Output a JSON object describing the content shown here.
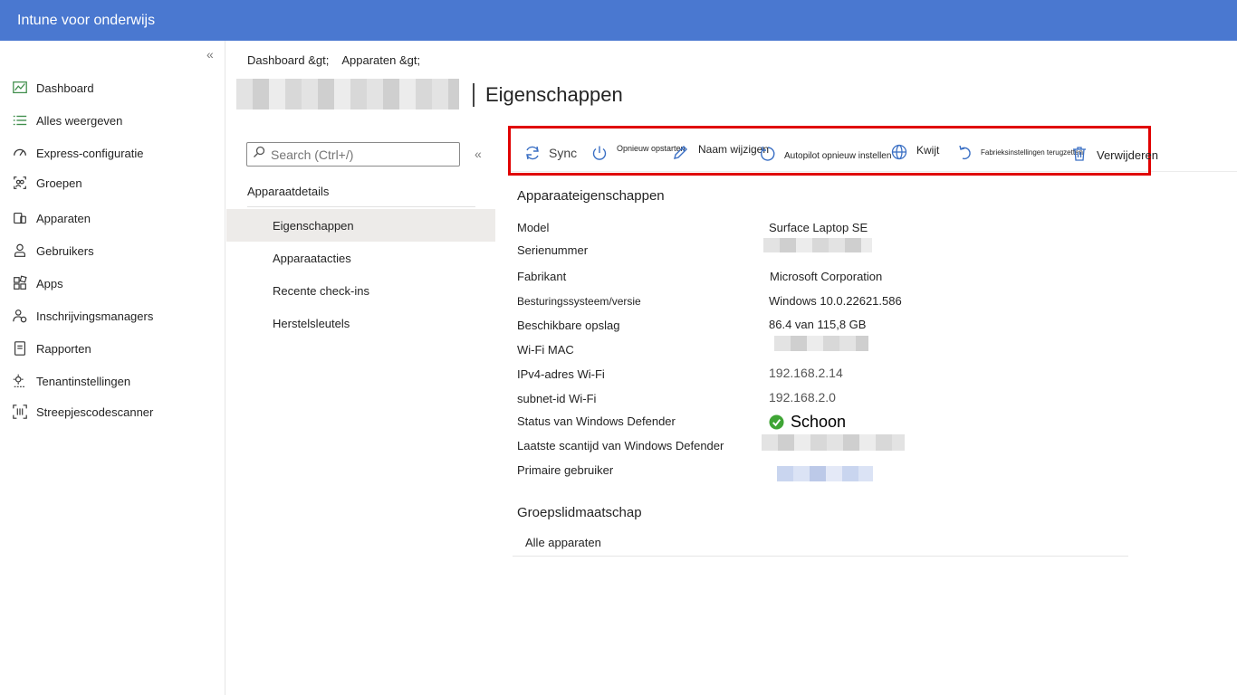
{
  "app": {
    "title": "Intune voor onderwijs"
  },
  "nav": {
    "collapse_glyph": "«",
    "items": [
      {
        "label": "Dashboard",
        "icon": "dashboard-icon"
      },
      {
        "label": "Alles weergeven",
        "icon": "list-icon"
      },
      {
        "label": "Express-configuratie",
        "icon": "gauge-icon"
      },
      {
        "label": "Groepen",
        "icon": "groups-icon"
      },
      {
        "label": "Apparaten",
        "icon": "devices-icon"
      },
      {
        "label": "Gebruikers",
        "icon": "person-icon"
      },
      {
        "label": "Apps",
        "icon": "apps-icon"
      },
      {
        "label": "Inschrijvingsmanagers",
        "icon": "enrollment-managers-icon"
      },
      {
        "label": "Rapporten",
        "icon": "reports-icon"
      },
      {
        "label": "Tenantinstellingen",
        "icon": "tenant-settings-icon"
      },
      {
        "label": "Streepjescodescanner",
        "icon": "barcode-icon"
      }
    ]
  },
  "breadcrumb": {
    "items": [
      "Dashboard &gt;",
      "Apparaten &gt;"
    ]
  },
  "page": {
    "title": "Eigenschappen"
  },
  "search": {
    "placeholder": "Search (Ctrl+/)",
    "value": ""
  },
  "subnav": {
    "collapse_glyph": "«",
    "header": "Apparaatdetails",
    "items": [
      {
        "label": "Eigenschappen",
        "active": true
      },
      {
        "label": "Apparaatacties",
        "active": false
      },
      {
        "label": "Recente check-ins",
        "active": false
      },
      {
        "label": "Herstelsleutels",
        "active": false
      }
    ]
  },
  "toolbar": {
    "sync": "Sync",
    "restart": "Opnieuw opstarten",
    "rename": "Naam wijzigen",
    "autopilot_reset": "Autopilot opnieuw instellen",
    "lost": "Kwijt",
    "factory_reset": "Fabrieksinstellingen terugzetten",
    "delete": "Verwijderen"
  },
  "properties": {
    "section_title": "Apparaateigenschappen",
    "rows": [
      {
        "label": "Model",
        "value": "Surface Laptop SE"
      },
      {
        "label": "Serienummer",
        "value": ""
      },
      {
        "label": "Fabrikant",
        "value": "Microsoft Corporation"
      },
      {
        "label": "Besturingssysteem/versie",
        "value": "Windows 10.0.22621.586"
      },
      {
        "label": "Beschikbare opslag",
        "value": "86.4 van 115,8 GB"
      },
      {
        "label": "Wi-Fi MAC",
        "value": ""
      },
      {
        "label": "IPv4-adres Wi-Fi",
        "value": "192.168.2.14"
      },
      {
        "label": "subnet-id Wi-Fi",
        "value": "192.168.2.0"
      },
      {
        "label": "Status van Windows Defender",
        "value": "Schoon"
      },
      {
        "label": "Laatste scantijd van Windows Defender",
        "value": ""
      },
      {
        "label": "Primaire gebruiker",
        "value": ""
      }
    ]
  },
  "groups": {
    "section_title": "Groepslidmaatschap",
    "items": [
      "Alle apparaten"
    ]
  },
  "colors": {
    "topbar": "#4a78d0",
    "toolbar_icon": "#3a6fc4",
    "highlight_border": "#e00000",
    "status_ok": "#3fa535",
    "active_nav": "#edebe9"
  }
}
